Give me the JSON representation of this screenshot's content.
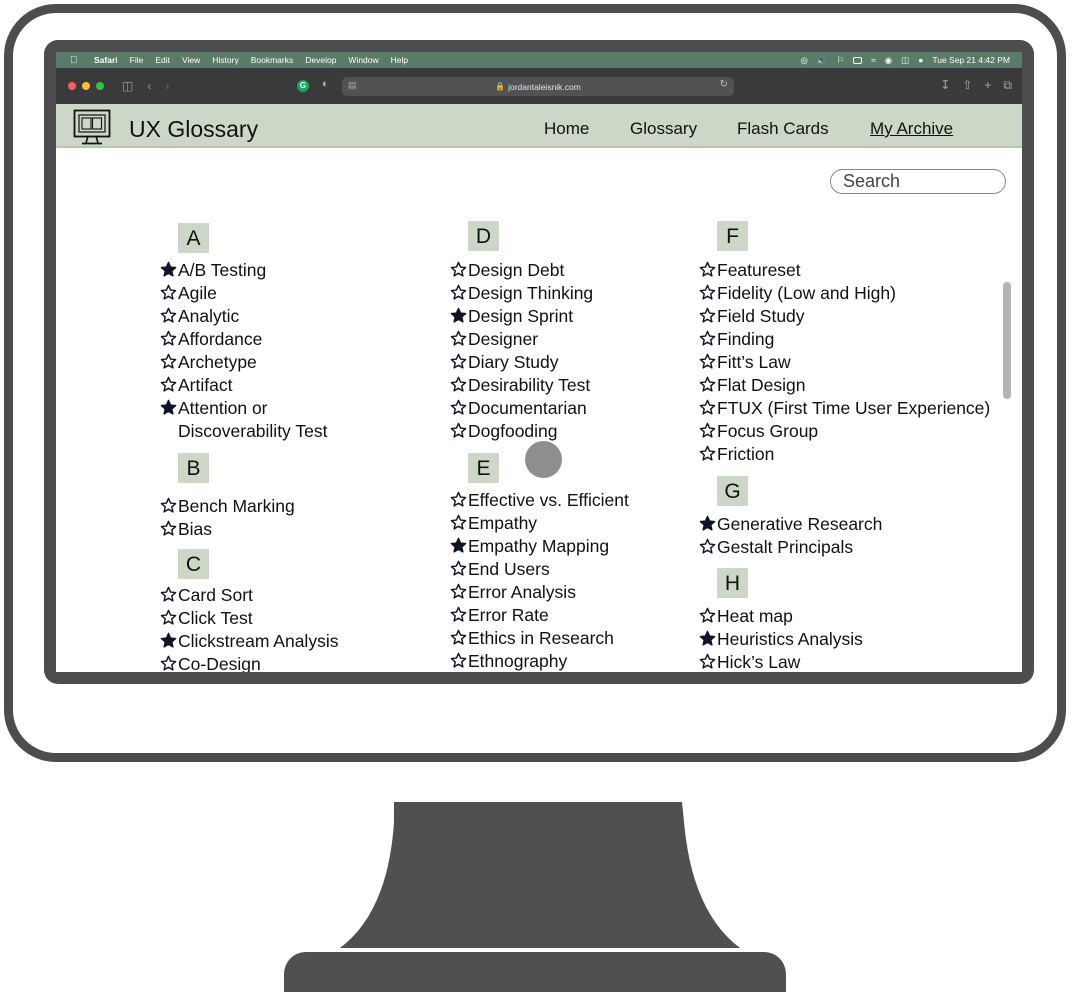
{
  "menubar": {
    "app": "Safari",
    "items": [
      "File",
      "Edit",
      "View",
      "History",
      "Bookmarks",
      "Develop",
      "Window",
      "Help"
    ],
    "clock": "Tue Sep 21  4:42 PM"
  },
  "browser": {
    "url": "jordantaleisnik.com"
  },
  "site": {
    "title": "UX Glossary",
    "nav": [
      "Home",
      "Glossary",
      "Flash Cards",
      "My Archive"
    ],
    "search_placeholder": "Search"
  },
  "glossary": {
    "letters": [
      "A",
      "B",
      "C",
      "D",
      "E",
      "F",
      "G",
      "H"
    ],
    "terms": [
      {
        "text": "A/B Testing",
        "starred": true
      },
      {
        "text": "Agile",
        "starred": false
      },
      {
        "text": "Analytic",
        "starred": false
      },
      {
        "text": "Affordance",
        "starred": false
      },
      {
        "text": "Archetype",
        "starred": false
      },
      {
        "text": "Artifact",
        "starred": false
      },
      {
        "text": "Attention or",
        "text2": "Discoverability Test",
        "starred": true
      },
      {
        "text": "Bench Marking",
        "starred": false
      },
      {
        "text": "Bias",
        "starred": false
      },
      {
        "text": "Card Sort",
        "starred": false
      },
      {
        "text": "Click Test",
        "starred": false
      },
      {
        "text": "Clickstream Analysis",
        "starred": true
      },
      {
        "text": "Co-Design",
        "starred": false
      },
      {
        "text": "Design Debt",
        "starred": false
      },
      {
        "text": "Design Thinking",
        "starred": false
      },
      {
        "text": "Design Sprint",
        "starred": true
      },
      {
        "text": "Designer",
        "starred": false
      },
      {
        "text": "Diary Study",
        "starred": false
      },
      {
        "text": "Desirability Test",
        "starred": false
      },
      {
        "text": "Documentarian",
        "starred": false
      },
      {
        "text": "Dogfooding",
        "starred": false
      },
      {
        "text": "Effective vs. Efficient",
        "starred": false
      },
      {
        "text": "Empathy",
        "starred": false
      },
      {
        "text": "Empathy Mapping",
        "starred": true
      },
      {
        "text": "End Users",
        "starred": false
      },
      {
        "text": "Error Analysis",
        "starred": false
      },
      {
        "text": "Error Rate",
        "starred": false
      },
      {
        "text": "Ethics in Research",
        "starred": false
      },
      {
        "text": "Ethnography",
        "starred": false
      },
      {
        "text": "Featureset",
        "starred": false
      },
      {
        "text": "Fidelity (Low and High)",
        "starred": false
      },
      {
        "text": "Field Study",
        "starred": false
      },
      {
        "text": "Finding",
        "starred": false
      },
      {
        "text": "Fitt’s Law",
        "starred": false
      },
      {
        "text": "Flat Design",
        "starred": false
      },
      {
        "text": "FTUX (First Time User Experience)",
        "starred": false
      },
      {
        "text": "Focus Group",
        "starred": false
      },
      {
        "text": "Friction",
        "starred": false
      },
      {
        "text": "Generative Research",
        "starred": true
      },
      {
        "text": "Gestalt Principals",
        "starred": false
      },
      {
        "text": "Heat map",
        "starred": false
      },
      {
        "text": "Heuristics Analysis",
        "starred": true
      },
      {
        "text": "Hick’s Law",
        "starred": false
      }
    ]
  },
  "colors": {
    "header_bg": "#cdd7c8",
    "menubar_bg": "#5a7a6a",
    "toolbar_bg": "#3a3a3c",
    "frame": "#4d4d4d",
    "star": "#101428"
  }
}
